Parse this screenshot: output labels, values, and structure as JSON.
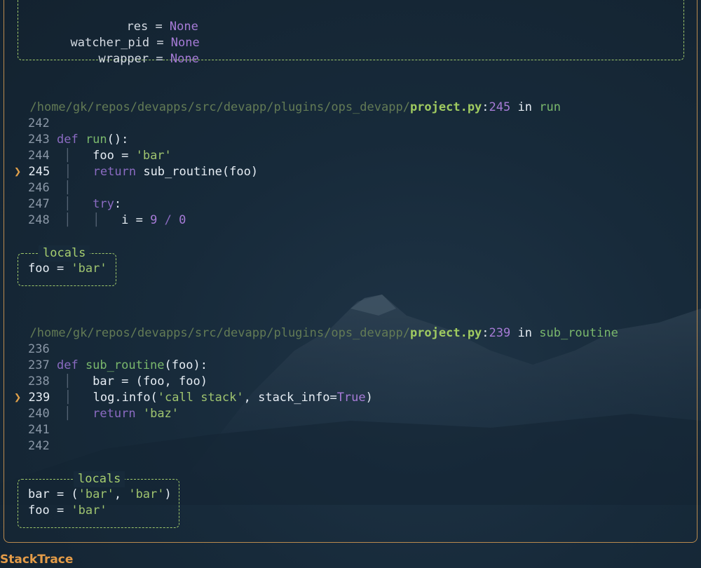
{
  "top_locals": {
    "res_name": "res",
    "res_value": "None",
    "watcher_name": "watcher_pid",
    "watcher_value": "None",
    "wrapper_name": "wrapper",
    "wrapper_value": "None"
  },
  "frame1": {
    "path_dir": "/home/gk/repos/devapps/src/devapp/plugins/ops_devapp/",
    "file": "project.py",
    "line": "245",
    "in_word": "in",
    "func": "run",
    "code": {
      "n242": "242",
      "n243": "243",
      "n244": "244",
      "n245": "245",
      "n246": "246",
      "n247": "247",
      "n248": "248",
      "def_kw": "def",
      "def_name": "run",
      "def_rest": "():",
      "foo_assign": "foo = ",
      "foo_str": "'bar'",
      "return_kw": "return",
      "return_rest": " sub_routine(foo)",
      "try_kw": "try",
      "try_colon": ":",
      "i_assign": "i = ",
      "nine": "9",
      "div": " / ",
      "zero": "0"
    },
    "locals_title": "locals",
    "locals": {
      "foo_name": "foo = ",
      "foo_val": "'bar'"
    }
  },
  "frame2": {
    "path_dir": "/home/gk/repos/devapps/src/devapp/plugins/ops_devapp/",
    "file": "project.py",
    "line": "239",
    "in_word": "in",
    "func": "sub_routine",
    "code": {
      "n236": "236",
      "n237": "237",
      "n238": "238",
      "n239": "239",
      "n240": "240",
      "n241": "241",
      "n242": "242",
      "def_kw": "def",
      "def_name": "sub_routine",
      "def_rest": "(foo):",
      "bar_assign": "bar = (foo, foo)",
      "log_pre": "log.info(",
      "log_str": "'call stack'",
      "log_mid": ", stack_info=",
      "log_true": "True",
      "log_end": ")",
      "return_kw": "return",
      "return_str": "'baz'"
    },
    "locals_title": "locals",
    "locals": {
      "bar_name": "bar = (",
      "bar_s1": "'bar'",
      "bar_sep": ", ",
      "bar_s2": "'bar'",
      "bar_end": ")",
      "foo_name": "foo = ",
      "foo_val": "'bar'"
    }
  },
  "arrow_glyph": "❯",
  "guide_glyph": "│",
  "footer": "StackTrace"
}
